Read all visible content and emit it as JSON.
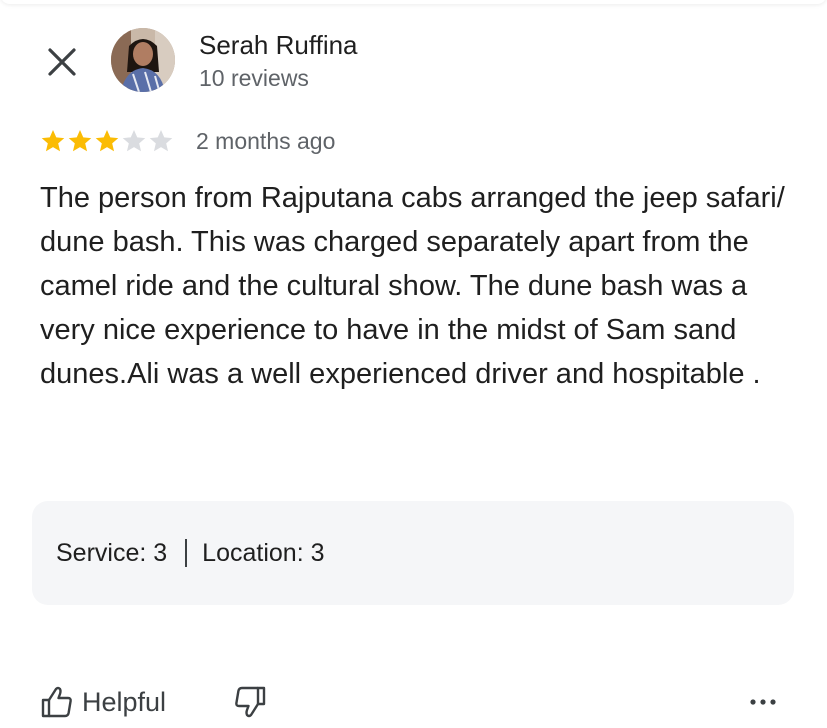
{
  "reviewer": {
    "name": "Serah Ruffina",
    "review_count": "10 reviews"
  },
  "review": {
    "rating": 3,
    "max_rating": 5,
    "date": "2 months ago",
    "text": "The person from Rajputana cabs arranged the jeep safari/ dune bash. This was charged separately apart from the camel ride and the cultural show. The dune bash was a very nice experience to have in the midst of Sam sand dunes.Ali was a well experienced driver and hospitable ."
  },
  "aspects": [
    {
      "label": "Service:",
      "value": "3"
    },
    {
      "label": "Location:",
      "value": "3"
    }
  ],
  "actions": {
    "helpful_label": "Helpful"
  },
  "icons": {
    "close": "close-icon",
    "thumbs_up": "thumbs-up-icon",
    "thumbs_down": "thumbs-down-icon",
    "more": "more-horizontal-icon"
  },
  "colors": {
    "star_filled": "#fbbc04",
    "star_empty": "#dadce0",
    "panel_bg": "#f5f6f8",
    "secondary_text": "#5f6368"
  }
}
